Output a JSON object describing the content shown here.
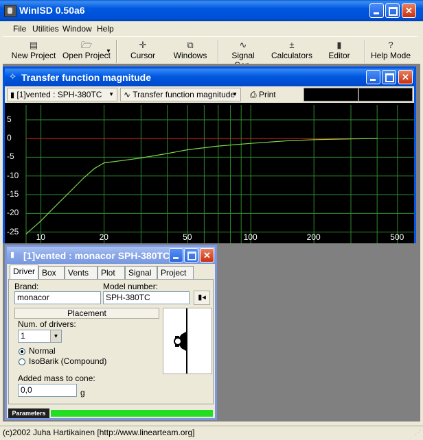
{
  "app": {
    "title": "WinISD 0.50a6"
  },
  "menu": [
    "File",
    "Utilities",
    "Window",
    "Help"
  ],
  "toolbar": {
    "new_project": "New Project",
    "open_project": "Open Project",
    "cursor": "Cursor",
    "windows": "Windows",
    "signal_gen": "Signal Gen.",
    "calculators": "Calculators",
    "editor": "Editor",
    "help_mode": "Help Mode"
  },
  "tf_window": {
    "title": "Transfer function magnitude",
    "project_select": "[1]vented : SPH-380TC",
    "graph_select": "Transfer function magnitude",
    "print": "Print"
  },
  "chart_data": {
    "type": "line",
    "title": "",
    "xlabel": "",
    "ylabel": "",
    "xscale": "log",
    "xlim": [
      8.5,
      600
    ],
    "ylim": [
      -28,
      9
    ],
    "x_tick_labels": [
      "10",
      "20",
      "50",
      "100",
      "200",
      "500"
    ],
    "y_tick_labels": [
      "5",
      "0",
      "-5",
      "-10",
      "-15",
      "-20",
      "-25"
    ],
    "grid": true,
    "reference_line": 0,
    "series": [
      {
        "color": "#7cd64a",
        "x": [
          8.5,
          10,
          12,
          14,
          16,
          18,
          20,
          25,
          30,
          40,
          50,
          70,
          100,
          150,
          200,
          300,
          400
        ],
        "y": [
          -25.5,
          -22,
          -17.5,
          -13.8,
          -10.5,
          -8,
          -6.5,
          -5.8,
          -5.2,
          -4,
          -3,
          -2,
          -1.3,
          -0.6,
          -0.3,
          -0.1,
          0
        ]
      }
    ],
    "colors": {
      "background": "#000000",
      "grid": "#2e8b2e",
      "zero_line": "#e02020",
      "curve": "#7cd64a"
    }
  },
  "driver_window": {
    "title": "[1]vented : monacor SPH-380TC",
    "tabs": [
      "Driver",
      "Box",
      "Vents",
      "Plot",
      "Signal",
      "Project"
    ],
    "active_tab": "Driver",
    "brand_label": "Brand:",
    "brand_value": "monacor",
    "model_label": "Model number:",
    "model_value": "SPH-380TC",
    "placement_button": "Placement",
    "num_drivers_label": "Num. of drivers:",
    "num_drivers_value": "1",
    "radio_normal": "Normal",
    "radio_isobarik": "IsoBarik (Compound)",
    "added_mass_label": "Added mass to cone:",
    "added_mass_value": "0,0",
    "added_mass_unit": "g",
    "parameters_label": "Parameters",
    "parameters_progress": 1.0
  },
  "status": {
    "text": "(c)2002 Juha Hartikainen [http://www.linearteam.org]"
  }
}
